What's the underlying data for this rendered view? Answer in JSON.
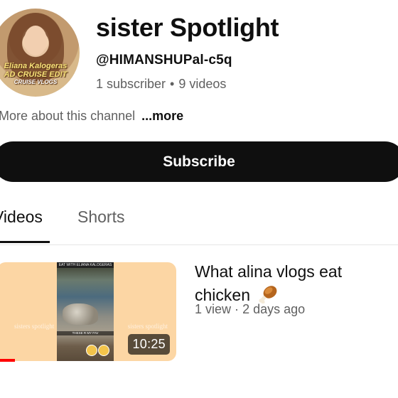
{
  "channel": {
    "name": "sister Spotlight",
    "handle": "@HIMANSHUPal-c5q",
    "subscribers": "1 subscriber",
    "separator": "•",
    "videos_count": "9 videos",
    "about": "More about this channel",
    "more": "...more",
    "avatar_caption": [
      "Eliana Kalogeras",
      "AD CRUISE EDIT",
      "CRUISE VLOGS"
    ]
  },
  "subscribe_label": "Subscribe",
  "tabs": [
    {
      "label": "Videos",
      "active": true
    },
    {
      "label": "Shorts",
      "active": false
    }
  ],
  "videos": [
    {
      "title": "What alina vlogs eat chicken",
      "title_emoji": "drumstick-icon",
      "views": "1 view",
      "separator": "·",
      "age": "2 days ago",
      "duration": "10:25",
      "watched_fraction": 0.1,
      "thumbnail": {
        "side_text": "sisters spotlight",
        "top_caption": "EAT WITH ELIANA KALOGERAS",
        "mid_caption": "THESE R MY FAV"
      }
    }
  ],
  "colors": {
    "thumbnail_bg": "#fcd6a4",
    "button_bg": "#0f0f0f",
    "progress": "#ff0000",
    "secondary_text": "#606060"
  }
}
